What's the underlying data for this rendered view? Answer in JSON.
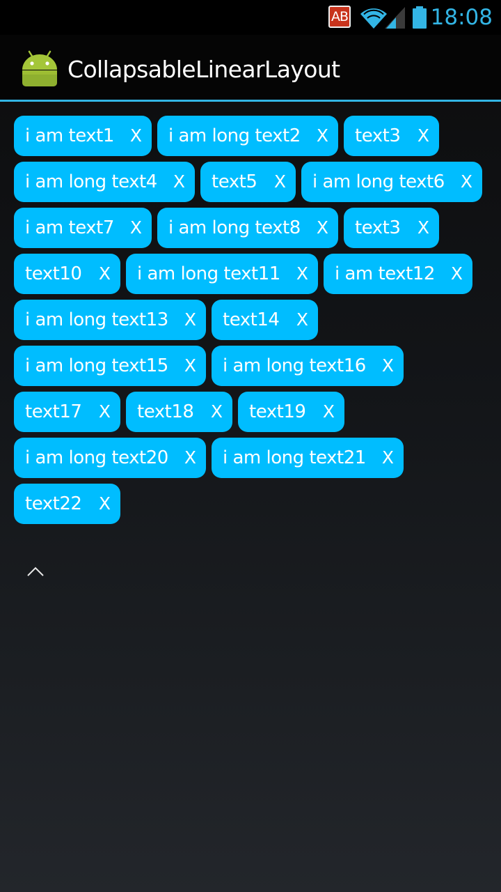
{
  "status_bar": {
    "ab_label": "AB",
    "time": "18:08",
    "accent_color": "#33b5e5"
  },
  "action_bar": {
    "title": "CollapsableLinearLayout",
    "icon": "android-robot-icon"
  },
  "tags": [
    {
      "label": "i am text1",
      "close": "X"
    },
    {
      "label": "i am long text2",
      "close": "X"
    },
    {
      "label": "text3",
      "close": "X"
    },
    {
      "label": "i am long text4",
      "close": "X"
    },
    {
      "label": "text5",
      "close": "X"
    },
    {
      "label": "i am long text6",
      "close": "X"
    },
    {
      "label": "i am text7",
      "close": "X"
    },
    {
      "label": "i am long text8",
      "close": "X"
    },
    {
      "label": "text3",
      "close": "X"
    },
    {
      "label": "text10",
      "close": "X"
    },
    {
      "label": "i am long text11",
      "close": "X"
    },
    {
      "label": "i am text12",
      "close": "X"
    },
    {
      "label": "i am long text13",
      "close": "X"
    },
    {
      "label": "text14",
      "close": "X"
    },
    {
      "label": "i am long text15",
      "close": "X"
    },
    {
      "label": "i am long text16",
      "close": "X"
    },
    {
      "label": "text17",
      "close": "X"
    },
    {
      "label": "text18",
      "close": "X"
    },
    {
      "label": "text19",
      "close": "X"
    },
    {
      "label": "i am long text20",
      "close": "X"
    },
    {
      "label": "i am long text21",
      "close": "X"
    },
    {
      "label": "text22",
      "close": "X"
    }
  ],
  "colors": {
    "tag_background": "#00bdff",
    "tag_text": "#ffffff"
  },
  "collapse_toggle": {
    "icon": "chevron-up-icon"
  }
}
